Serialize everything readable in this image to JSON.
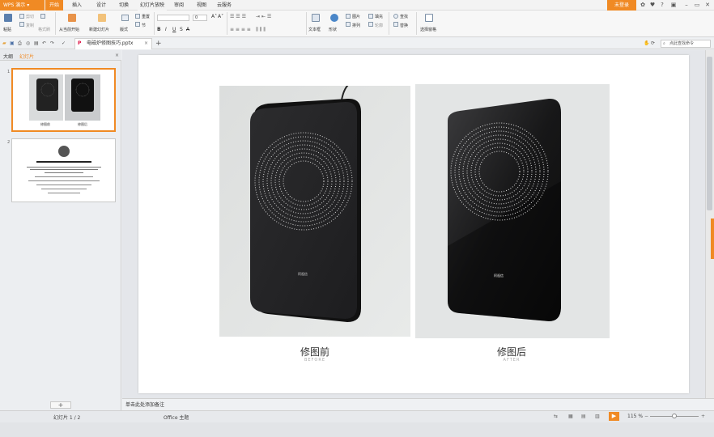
{
  "app": {
    "name": "WPS 演示"
  },
  "menu_tabs": [
    "开始",
    "插入",
    "设计",
    "切换",
    "动画",
    "幻灯片放映",
    "审阅",
    "视图",
    "云服务"
  ],
  "active_tab": "开始",
  "login_label": "未登录",
  "ribbon": {
    "paste": "粘贴",
    "cut": "剪切",
    "copy": "复制",
    "format_painter": "格式刷",
    "from_current": "从当前开始",
    "new_slide": "新建幻灯片",
    "layout": "版式",
    "section": "节",
    "reset": "重置",
    "font_size_value": "0",
    "text_box": "文本框",
    "shape": "形状",
    "picture": "图片",
    "fill": "填充",
    "arrange": "排列",
    "outline": "轮廓",
    "find": "查找",
    "replace": "替换",
    "select_pane": "选择窗格"
  },
  "document_tab": {
    "filename": "电磁炉修图技巧.pptx"
  },
  "search": {
    "placeholder": "点此查找命令"
  },
  "left_panel": {
    "tab_outline": "大纲",
    "tab_slides": "幻灯片"
  },
  "thumbnails": [
    {
      "num": "1",
      "caption_left": "修图前",
      "caption_right": "修图后"
    },
    {
      "num": "2"
    }
  ],
  "slide": {
    "left_title": "修图前",
    "left_sub": "BEFORE",
    "right_title": "修图后",
    "right_sub": "AFTER",
    "product_label": "阿祖信"
  },
  "notes_placeholder": "单击此处添加备注",
  "status": {
    "slide_counter": "幻灯片 1 / 2",
    "theme": "Office 主题",
    "zoom": "115 %"
  },
  "colors": {
    "accent": "#f08a24"
  }
}
